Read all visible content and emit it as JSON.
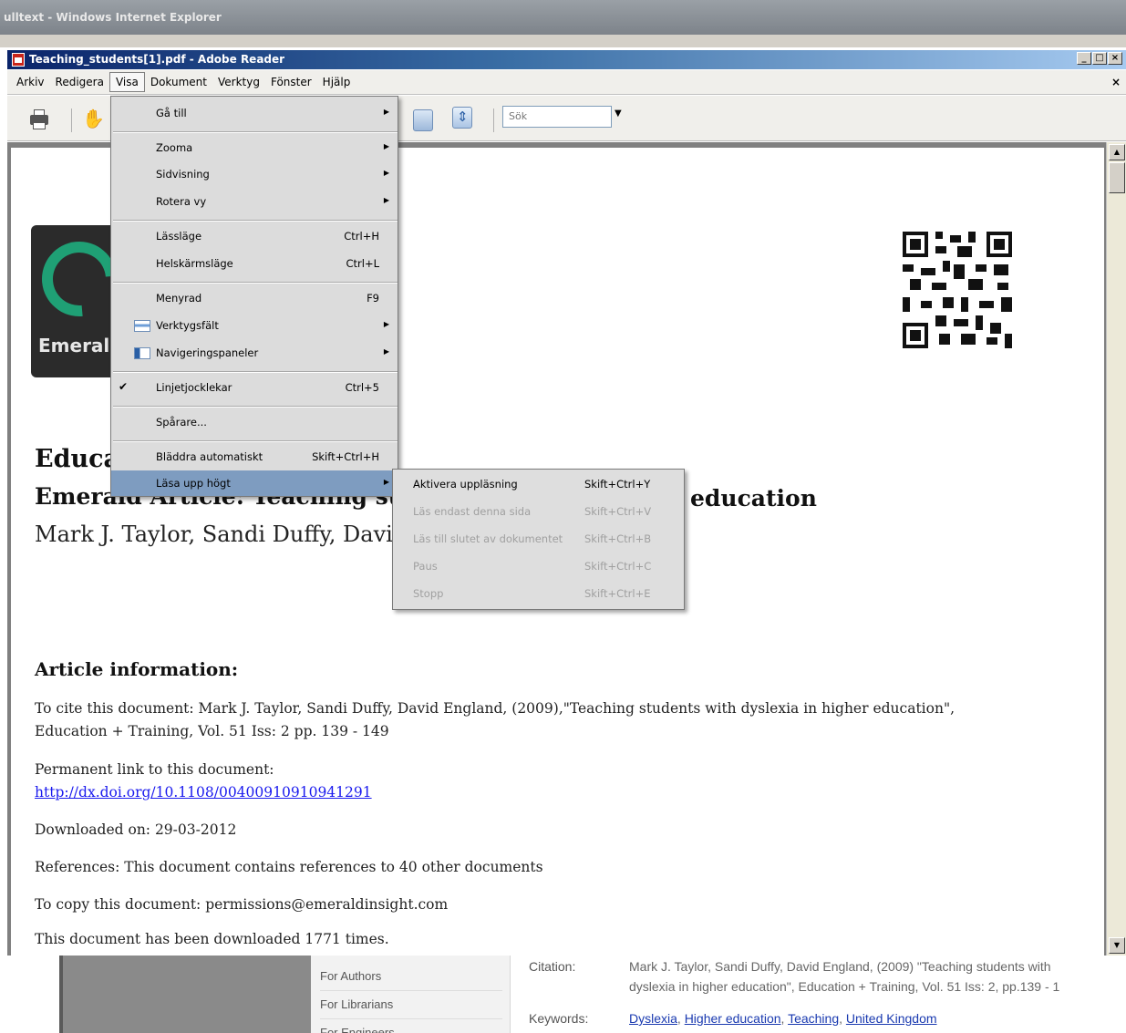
{
  "ie_window": {
    "title": "ulltext - Windows Internet Explorer"
  },
  "reader_window": {
    "title": "Teaching_students[1].pdf - Adobe Reader",
    "controls": [
      "_",
      "□",
      "×"
    ],
    "close_doc": "×"
  },
  "menubar": {
    "items": [
      "Arkiv",
      "Redigera",
      "Visa",
      "Dokument",
      "Verktyg",
      "Fönster",
      "Hjälp"
    ],
    "active_index": 2
  },
  "toolbar": {
    "search_placeholder": "Sök",
    "icons": [
      "printer-icon",
      "hand-icon",
      "fit-page-icon",
      "fit-width-icon"
    ]
  },
  "view_menu": {
    "items": [
      {
        "label": "Gå till",
        "shortcut": "",
        "submenu": true
      },
      {
        "label": "Zooma",
        "shortcut": "",
        "submenu": true
      },
      {
        "label": "Sidvisning",
        "shortcut": "",
        "submenu": true
      },
      {
        "label": "Rotera vy",
        "shortcut": "",
        "submenu": true
      },
      {
        "label": "Lässläge",
        "shortcut": "Ctrl+H",
        "submenu": false
      },
      {
        "label": "Helskärmsläge",
        "shortcut": "Ctrl+L",
        "submenu": false
      },
      {
        "label": "Menyrad",
        "shortcut": "F9",
        "submenu": false
      },
      {
        "label": "Verktygsfält",
        "shortcut": "",
        "submenu": true,
        "icon": "toolbar-icon"
      },
      {
        "label": "Navigeringspaneler",
        "shortcut": "",
        "submenu": true,
        "icon": "panels-icon"
      },
      {
        "label": "Linjetjocklekar",
        "shortcut": "Ctrl+5",
        "submenu": false,
        "checked": true
      },
      {
        "label": "Spårare...",
        "shortcut": "",
        "submenu": false
      },
      {
        "label": "Bläddra automatiskt",
        "shortcut": "Skift+Ctrl+H",
        "submenu": false
      },
      {
        "label": "Läsa upp högt",
        "shortcut": "",
        "submenu": true,
        "highlighted": true
      }
    ]
  },
  "read_aloud_menu": {
    "items": [
      {
        "label": "Aktivera uppläsning",
        "shortcut": "Skift+Ctrl+Y",
        "enabled": true
      },
      {
        "label": "Läs endast denna sida",
        "shortcut": "Skift+Ctrl+V",
        "enabled": false
      },
      {
        "label": "Läs till slutet av dokumentet",
        "shortcut": "Skift+Ctrl+B",
        "enabled": false
      },
      {
        "label": "Paus",
        "shortcut": "Skift+Ctrl+C",
        "enabled": false
      },
      {
        "label": "Stopp",
        "shortcut": "Skift+Ctrl+E",
        "enabled": false
      }
    ]
  },
  "document": {
    "logo_text": "Emerald",
    "title_visible": "Educa",
    "subtitle_left": "Emerald Article: Teaching stude",
    "subtitle_right": "education",
    "authors": "Mark J. Taylor, Sandi Duffy, Davi",
    "article_info_heading": "Article information:",
    "cite_line1": "To cite this document: Mark J. Taylor, Sandi Duffy, David England, (2009),\"Teaching students with dyslexia in higher education\",",
    "cite_line2": "Education + Training, Vol. 51 Iss: 2 pp. 139 - 149",
    "permalink_label": "Permanent link to this document:",
    "permalink": "http://dx.doi.org/10.1108/00400910910941291",
    "downloaded_on": "Downloaded on: 29-03-2012",
    "references": "References: This document contains references to 40 other documents",
    "copy_info": "To copy this document: permissions@emeraldinsight.com",
    "download_count": "This document has been downloaded 1771 times."
  },
  "web_page": {
    "nav_items": [
      "For Authors",
      "For Librarians",
      "For Engineers"
    ],
    "citation_label": "Citation:",
    "citation_line1": "Mark J. Taylor, Sandi Duffy, David England, (2009) \"Teaching students with",
    "citation_line2": "dyslexia in higher education\", Education + Training, Vol. 51 Iss: 2, pp.139 - 1",
    "keywords_label": "Keywords:",
    "keywords": [
      "Dyslexia",
      "Higher education",
      "Teaching",
      "United Kingdom"
    ]
  }
}
